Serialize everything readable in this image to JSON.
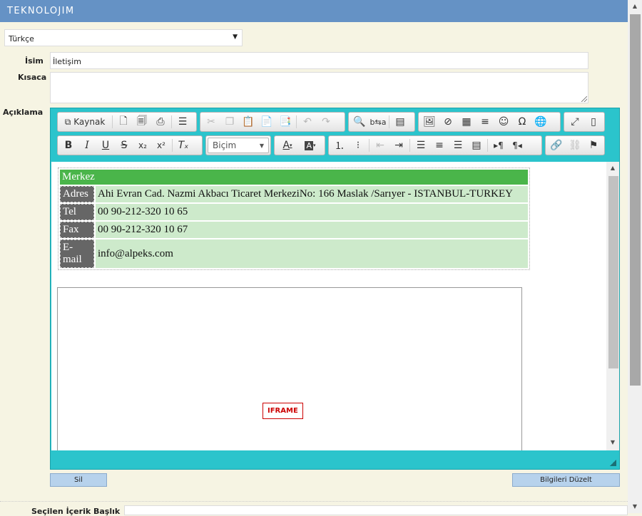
{
  "app": {
    "logo": "TEKNOLOJIM"
  },
  "language_select": {
    "value": "Türkçe"
  },
  "form": {
    "name_label": "İsim",
    "name_value": "İletişim",
    "summary_label": "Kısaca",
    "summary_value": "",
    "description_label": "Açıklama",
    "selected_content_label": "Seçilen İçerik Başlık"
  },
  "toolbar": {
    "source_label": "Kaynak",
    "format_label": "Biçim"
  },
  "content": {
    "header": "Merkez",
    "rows": [
      {
        "key": "Adres",
        "value": "Ahi Evran Cad. Nazmi Akbacı Ticaret MerkeziNo: 166  Maslak /Sarıyer  - ISTANBUL-TURKEY"
      },
      {
        "key": "Tel",
        "value": "00 90-212-320 10 65"
      },
      {
        "key": "Fax",
        "value": "00 90-212-320 10 67"
      },
      {
        "key": "E-mail",
        "value": "info@alpeks.com"
      }
    ],
    "iframe_label": "IFRAME"
  },
  "buttons": {
    "delete_label": "Sil",
    "update_label": "Bilgileri Düzelt"
  },
  "colors": {
    "topbar": "#6592c5",
    "editor_chrome": "#2bc4cc",
    "table_header": "#4ab54a",
    "table_key": "#666666",
    "table_value": "#cdeacb"
  }
}
